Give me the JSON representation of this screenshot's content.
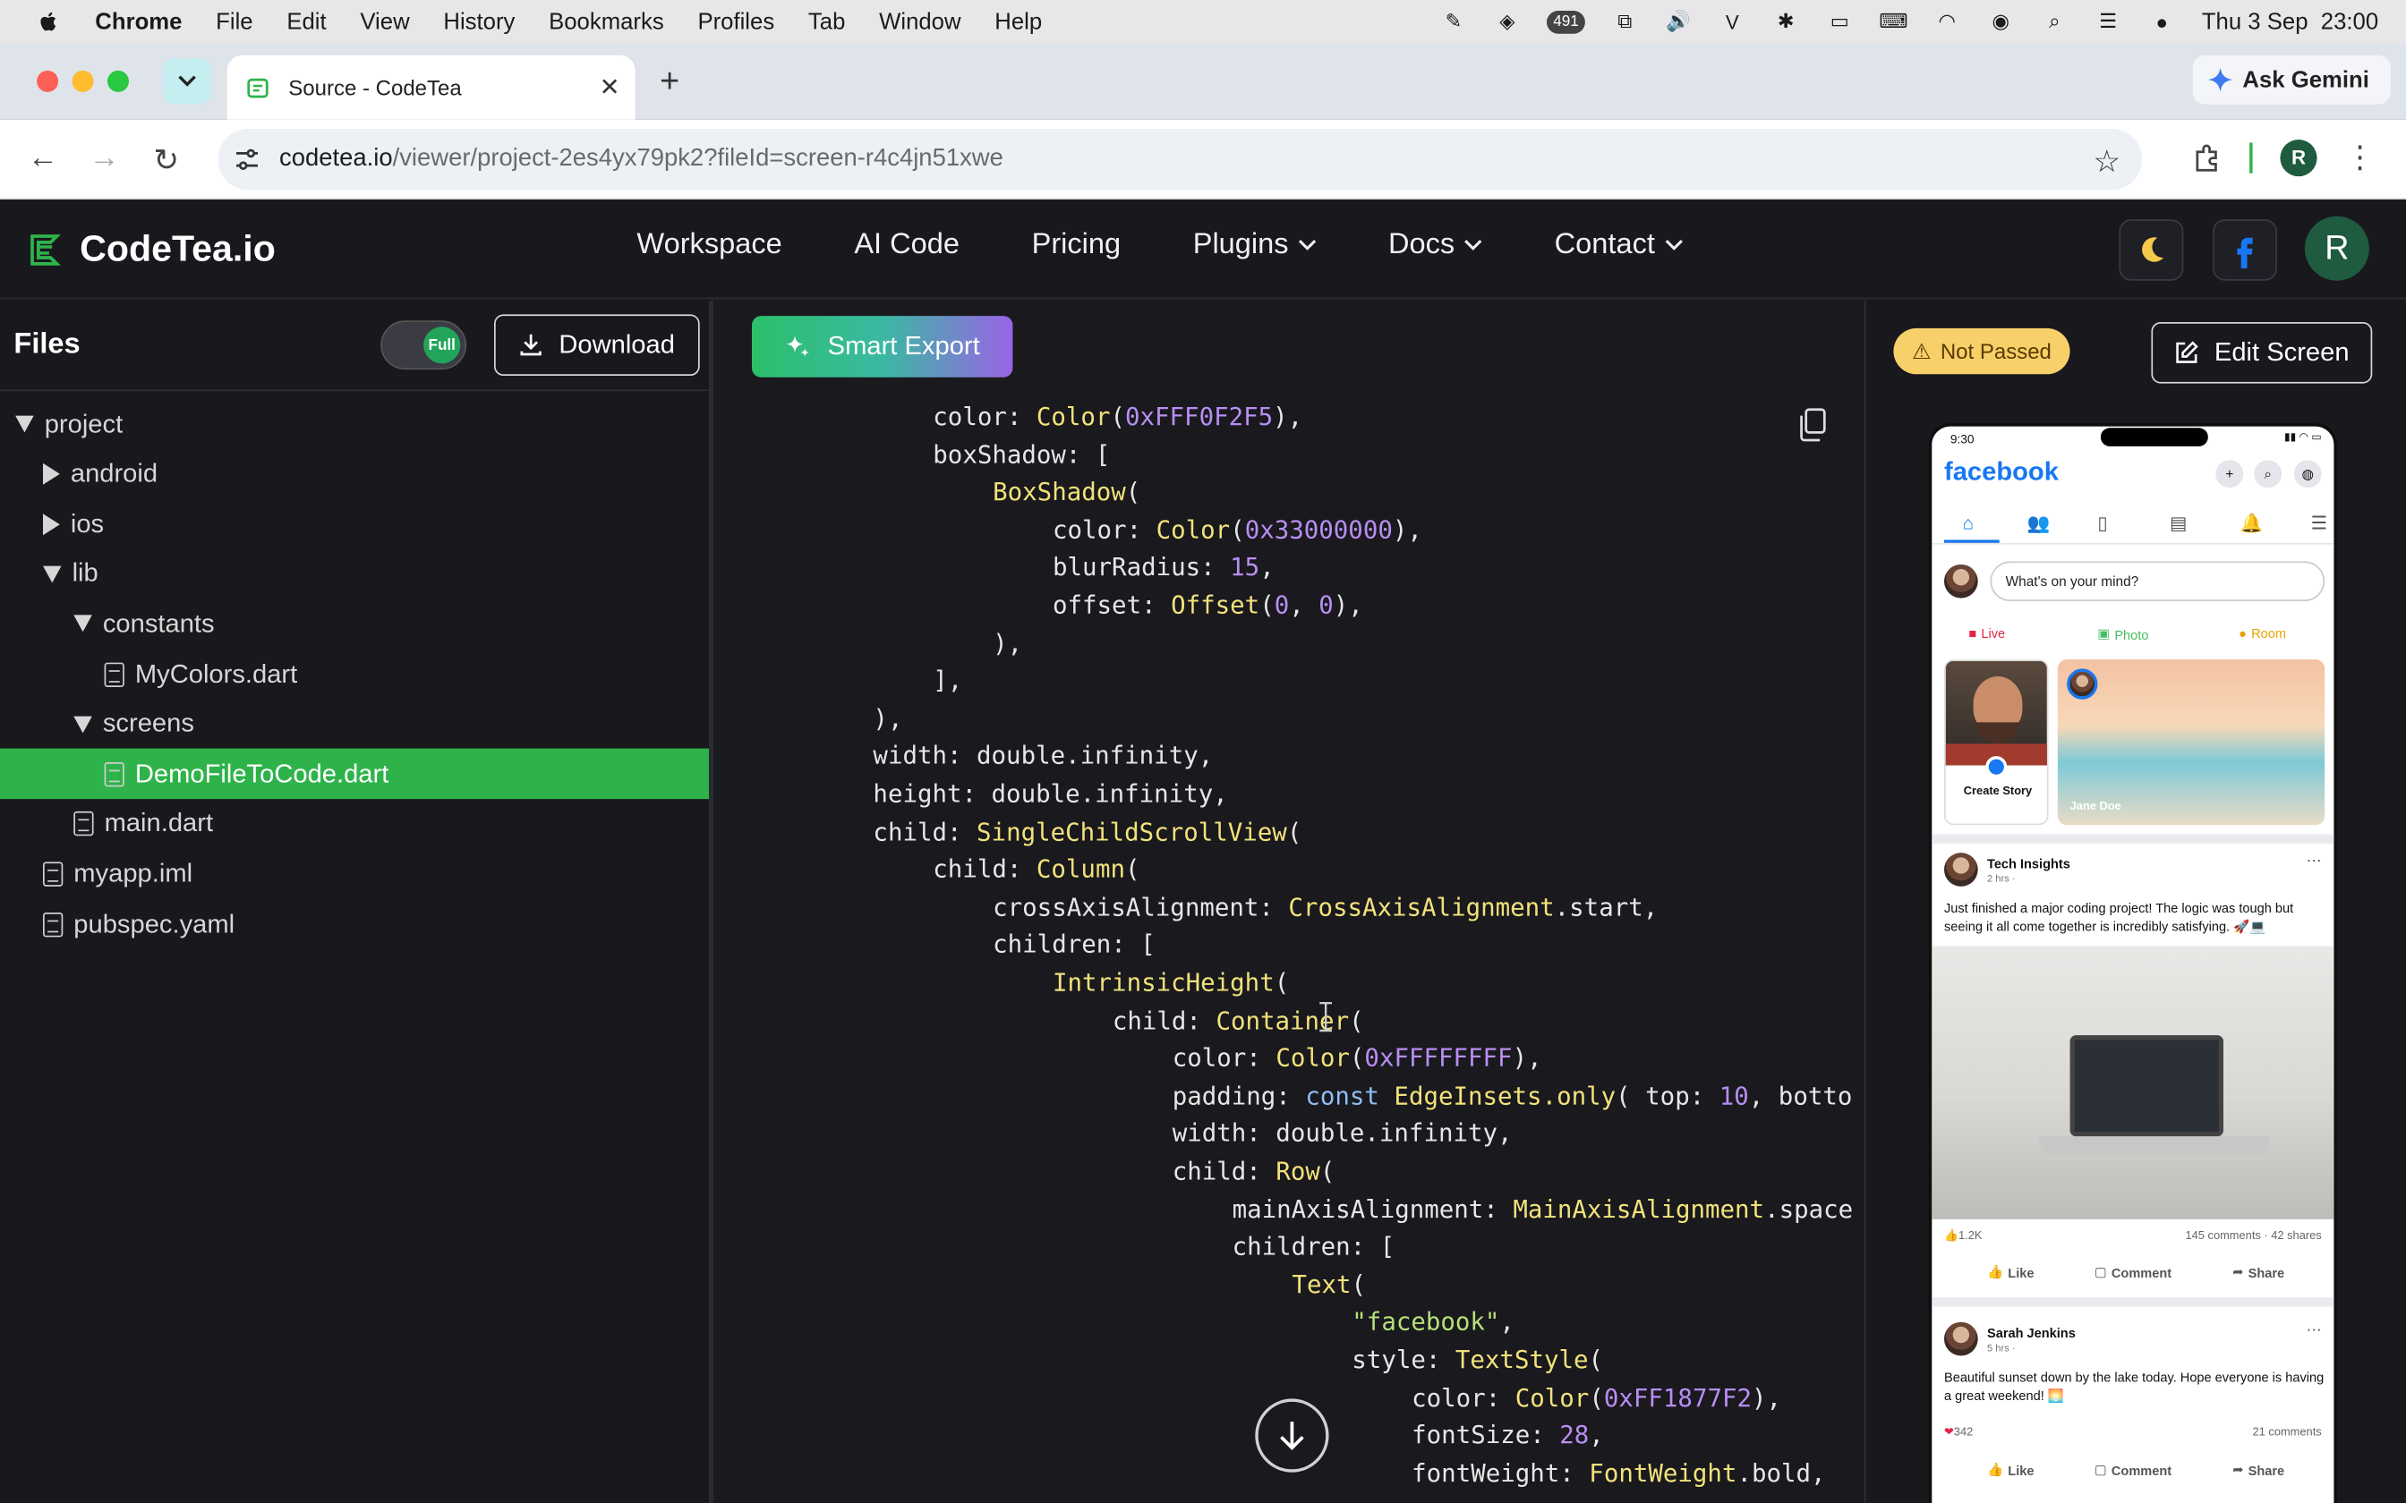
{
  "menubar": {
    "app": "Chrome",
    "items": [
      "File",
      "Edit",
      "View",
      "History",
      "Bookmarks",
      "Profiles",
      "Tab",
      "Window",
      "Help"
    ],
    "badge_count": "491",
    "datetime": "Thu 3 Sep  23:00"
  },
  "browser": {
    "tab_title": "Source - CodeTea",
    "ask_gemini": "Ask Gemini",
    "url_host": "codetea.io",
    "url_path": "/viewer/project-2es4yx79pk2?fileId=screen-r4c4jn51xwe",
    "profile_initial": "R"
  },
  "site": {
    "logo_text": "CodeTea.io",
    "nav": [
      "Workspace",
      "AI Code",
      "Pricing",
      "Plugins",
      "Docs",
      "Contact"
    ],
    "avatar_initial": "R"
  },
  "files": {
    "title": "Files",
    "toggle_label": "Full",
    "download_label": "Download",
    "tree": [
      {
        "label": "project",
        "type": "folder-open",
        "depth": 0
      },
      {
        "label": "android",
        "type": "folder-closed",
        "depth": 1
      },
      {
        "label": "ios",
        "type": "folder-closed",
        "depth": 1
      },
      {
        "label": "lib",
        "type": "folder-open",
        "depth": 1
      },
      {
        "label": "constants",
        "type": "folder-open",
        "depth": 2
      },
      {
        "label": "MyColors.dart",
        "type": "file",
        "depth": 3
      },
      {
        "label": "screens",
        "type": "folder-open",
        "depth": 2
      },
      {
        "label": "DemoFileToCode.dart",
        "type": "file",
        "depth": 3,
        "selected": true
      },
      {
        "label": "main.dart",
        "type": "file",
        "depth": 2
      },
      {
        "label": "myapp.iml",
        "type": "file",
        "depth": 1
      },
      {
        "label": "pubspec.yaml",
        "type": "file",
        "depth": 1
      }
    ]
  },
  "code": {
    "smart_export_label": "Smart Export",
    "lines": [
      [
        [
          "color: ",
          ""
        ],
        [
          "Color",
          "y"
        ],
        [
          "(",
          ""
        ],
        [
          "0xFFF0F2F5",
          "p"
        ],
        [
          "),",
          ""
        ]
      ],
      [
        [
          "boxShadow: [",
          ""
        ]
      ],
      [
        [
          "BoxShadow",
          "y"
        ],
        [
          "(",
          ""
        ]
      ],
      [
        [
          "color: ",
          ""
        ],
        [
          "Color",
          "y"
        ],
        [
          "(",
          ""
        ],
        [
          "0x33000000",
          "p"
        ],
        [
          "),",
          ""
        ]
      ],
      [
        [
          "blurRadius: ",
          ""
        ],
        [
          "15",
          "p"
        ],
        [
          ",",
          ""
        ]
      ],
      [
        [
          "offset: ",
          ""
        ],
        [
          "Offset",
          "y"
        ],
        [
          "(",
          ""
        ],
        [
          "0",
          "p"
        ],
        [
          ", ",
          ""
        ],
        [
          "0",
          "p"
        ],
        [
          "),",
          ""
        ]
      ],
      [
        [
          "),",
          ""
        ]
      ],
      [
        [
          "],",
          ""
        ]
      ],
      [
        [
          "),",
          ""
        ]
      ],
      [
        [
          "width: double.infinity,",
          ""
        ]
      ],
      [
        [
          "height: double.infinity,",
          ""
        ]
      ],
      [
        [
          "child: ",
          ""
        ],
        [
          "SingleChildScrollView",
          "y"
        ],
        [
          "(",
          ""
        ]
      ],
      [
        [
          "child: ",
          ""
        ],
        [
          "Column",
          "y"
        ],
        [
          "(",
          ""
        ]
      ],
      [
        [
          "crossAxisAlignment: ",
          ""
        ],
        [
          "CrossAxisAlignment",
          "y"
        ],
        [
          ".start,",
          ""
        ]
      ],
      [
        [
          "children: [",
          ""
        ]
      ],
      [
        [
          "IntrinsicHeight",
          "y"
        ],
        [
          "(",
          ""
        ]
      ],
      [
        [
          "child: ",
          ""
        ],
        [
          "Container",
          "y"
        ],
        [
          "(",
          ""
        ]
      ],
      [
        [
          "color: ",
          ""
        ],
        [
          "Color",
          "y"
        ],
        [
          "(",
          ""
        ],
        [
          "0xFFFFFFFF",
          "p"
        ],
        [
          "),",
          ""
        ]
      ],
      [
        [
          "padding: ",
          ""
        ],
        [
          "const ",
          "b"
        ],
        [
          "EdgeInsets",
          "y"
        ],
        [
          ".only",
          "y"
        ],
        [
          "( top: ",
          ""
        ],
        [
          "10",
          "p"
        ],
        [
          ", botto",
          ""
        ]
      ],
      [
        [
          "width: double.infinity,",
          ""
        ]
      ],
      [
        [
          "child: ",
          ""
        ],
        [
          "Row",
          "y"
        ],
        [
          "(",
          ""
        ]
      ],
      [
        [
          "mainAxisAlignment: ",
          ""
        ],
        [
          "MainAxisAlignment",
          "y"
        ],
        [
          ".space",
          ""
        ]
      ],
      [
        [
          "children: [",
          ""
        ]
      ],
      [
        [
          "Text",
          "y"
        ],
        [
          "(",
          ""
        ]
      ],
      [
        [
          "\"facebook\"",
          "g"
        ],
        [
          ",",
          ""
        ]
      ],
      [
        [
          "style: ",
          ""
        ],
        [
          "TextStyle",
          "y"
        ],
        [
          "(",
          ""
        ]
      ],
      [
        [
          "color: ",
          ""
        ],
        [
          "Color",
          "y"
        ],
        [
          "(",
          ""
        ],
        [
          "0xFF1877F2",
          "p"
        ],
        [
          "),",
          ""
        ]
      ],
      [
        [
          "fontSize: ",
          ""
        ],
        [
          "28",
          "p"
        ],
        [
          ",",
          ""
        ]
      ],
      [
        [
          "fontWeight: ",
          ""
        ],
        [
          "FontWeight",
          "y"
        ],
        [
          ".bold,",
          ""
        ]
      ]
    ]
  },
  "preview": {
    "status_badge": "Not Passed",
    "edit_label": "Edit Screen",
    "phone": {
      "time": "9:30",
      "brand": "facebook",
      "composer_placeholder": "What's on your mind?",
      "quick_actions": [
        "Live",
        "Photo",
        "Room"
      ],
      "create_story": "Create Story",
      "story_name": "Jane Doe",
      "post1": {
        "author": "Tech Insights",
        "time": "2 hrs ·",
        "text": "Just finished a major coding project! The logic was tough but seeing it all come together is incredibly satisfying. 🚀💻",
        "likes": "1.2K",
        "stats": "145 comments · 42 shares"
      },
      "post2": {
        "author": "Sarah Jenkins",
        "time": "5 hrs ·",
        "text": "Beautiful sunset down by the lake today. Hope everyone is having a great weekend! 🌅",
        "likes": "342",
        "stats": "21 comments"
      },
      "actions": [
        "Like",
        "Comment",
        "Share"
      ]
    }
  },
  "colors": {
    "accent_green": "#2eb34a",
    "facebook_blue": "#1877f2",
    "badge_yellow": "#f7d06a"
  }
}
